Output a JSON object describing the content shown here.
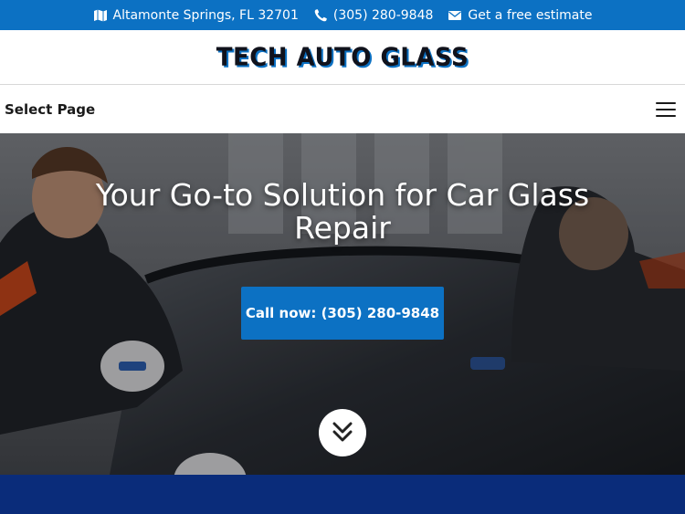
{
  "topbar": {
    "address": "Altamonte Springs, FL 32701",
    "phone": "(305) 280-9848",
    "estimate": "Get a free estimate",
    "icons": [
      "map-icon",
      "phone-icon",
      "envelope-icon"
    ]
  },
  "header": {
    "logo": "TECH AUTO GLASS"
  },
  "nav": {
    "select_page": "Select Page",
    "menu_icon": "hamburger-icon"
  },
  "hero": {
    "title_line1": "Your Go-to Solution for Car Glass",
    "title_line2": "Repair",
    "cta": "Call now: (305) 280-9848",
    "scroll_icon": "double-chevron-down-icon"
  },
  "colors": {
    "accent": "#0c71c3",
    "dark_band": "#0a2c7a",
    "logo_text": "#10121c"
  }
}
